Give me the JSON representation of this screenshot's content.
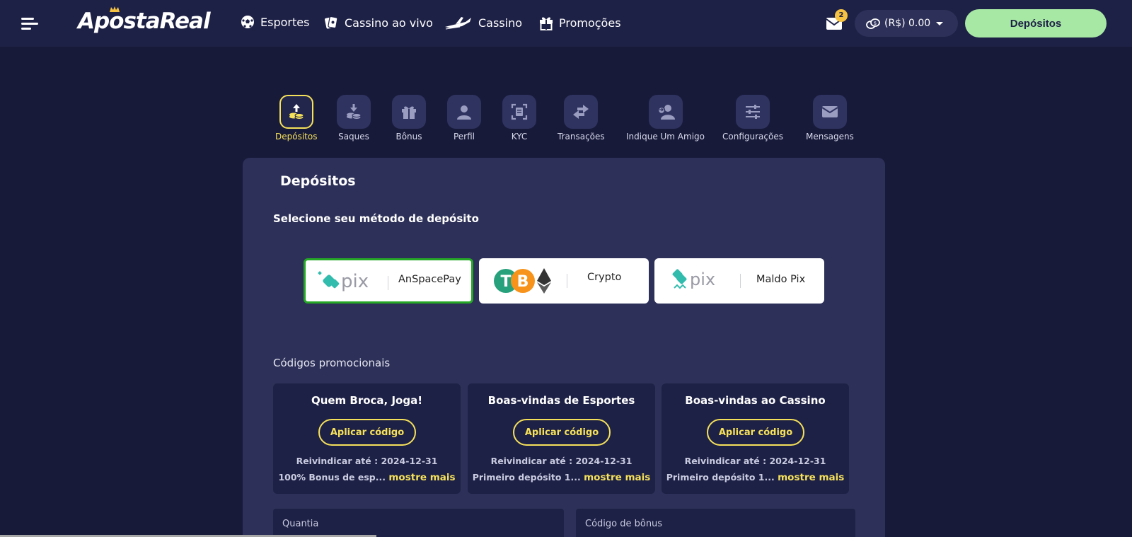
{
  "header": {
    "logo": "ApostaReal",
    "nav": [
      {
        "label": "Esportes",
        "icon": "soccer-ball-icon"
      },
      {
        "label": "Cassino ao vivo",
        "icon": "cards-icon"
      },
      {
        "label": "Cassino",
        "icon": "airplane-icon"
      },
      {
        "label": "Promoções",
        "icon": "gift-icon"
      }
    ],
    "mail_count": "2",
    "balance": "(R$) 0.00",
    "deposit_button": "Depósitos"
  },
  "tabs": [
    {
      "label": "Depósitos",
      "icon": "deposit-icon",
      "active": true
    },
    {
      "label": "Saques",
      "icon": "withdraw-icon",
      "active": false
    },
    {
      "label": "Bônus",
      "icon": "gift-icon",
      "active": false
    },
    {
      "label": "Perfil",
      "icon": "user-icon",
      "active": false
    },
    {
      "label": "KYC",
      "icon": "id-scan-icon",
      "active": false
    },
    {
      "label": "Transações",
      "icon": "transfer-arrows-icon",
      "active": false
    },
    {
      "label": "Indique Um Amigo",
      "icon": "refer-friend-icon",
      "active": false
    },
    {
      "label": "Configurações",
      "icon": "sliders-icon",
      "active": false
    },
    {
      "label": "Mensagens",
      "icon": "envelope-icon",
      "active": false
    }
  ],
  "panel": {
    "title": "Depósitos",
    "method_prompt": "Selecione seu método de depósito",
    "methods": [
      {
        "name": "AnSpacePay",
        "logo": "pix",
        "selected": true
      },
      {
        "name": "Crypto",
        "logo": "crypto-coins",
        "selected": false
      },
      {
        "name": "Maldo Pix",
        "logo": "pix",
        "selected": false
      }
    ],
    "promo_heading": "Códigos promocionais",
    "promos": [
      {
        "title": "Quem Broca, Joga!",
        "button": "Aplicar código",
        "claim": "Reivindicar até : 2024-12-31",
        "desc": "100% Bonus de esp...",
        "more": "mostre mais"
      },
      {
        "title": "Boas-vindas de Esportes",
        "button": "Aplicar código",
        "claim": "Reivindicar até : 2024-12-31",
        "desc": "Primeiro depósito 1...",
        "more": "mostre mais"
      },
      {
        "title": "Boas-vindas ao Cassino",
        "button": "Aplicar código",
        "claim": "Reivindicar até : 2024-12-31",
        "desc": "Primeiro depósito 1...",
        "more": "mostre mais"
      }
    ],
    "amount_label": "Quantia",
    "bonus_code_label": "Código de bônus"
  },
  "colors": {
    "background": "#181a3a",
    "header": "#1e2146",
    "panel": "#2d3058",
    "accent_yellow": "#f5e15a",
    "deposit_green": "#a7e8a4",
    "selected_border": "#25a826"
  }
}
